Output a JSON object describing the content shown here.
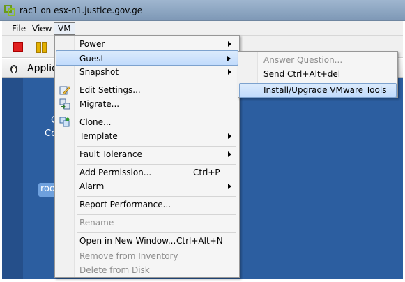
{
  "window": {
    "title": "rac1 on esx-n1.justice.gov.ge"
  },
  "menubar": {
    "items": [
      "File",
      "View",
      "VM"
    ],
    "active": "VM"
  },
  "toolbar": {
    "buttons": [
      "stop-icon",
      "pause-icon"
    ]
  },
  "appbar": {
    "label": "Applic"
  },
  "desktop": {
    "partial_text_1": "C",
    "partial_text_2": "Co",
    "user_badge": "roo"
  },
  "vm_menu": {
    "items": [
      {
        "label": "Power",
        "submenu": true
      },
      {
        "label": "Guest",
        "submenu": true,
        "highlighted": true
      },
      {
        "label": "Snapshot",
        "submenu": true
      },
      {
        "label": "Edit Settings...",
        "icon": "edit-settings-icon"
      },
      {
        "label": "Migrate...",
        "icon": "migrate-icon"
      },
      {
        "label": "Clone...",
        "icon": "clone-icon"
      },
      {
        "label": "Template",
        "submenu": true
      },
      {
        "label": "Fault Tolerance",
        "submenu": true
      },
      {
        "label": "Add Permission...",
        "shortcut": "Ctrl+P"
      },
      {
        "label": "Alarm",
        "submenu": true
      },
      {
        "label": "Report Performance..."
      },
      {
        "label": "Rename",
        "disabled": true
      },
      {
        "label": "Open in New Window...",
        "shortcut": "Ctrl+Alt+N"
      },
      {
        "label": "Remove from Inventory",
        "disabled": true
      },
      {
        "label": "Delete from Disk",
        "disabled": true
      }
    ]
  },
  "guest_submenu": {
    "items": [
      {
        "label": "Answer Question...",
        "disabled": true
      },
      {
        "label": "Send Ctrl+Alt+del"
      },
      {
        "label": "Install/Upgrade VMware Tools",
        "highlighted": true
      }
    ]
  },
  "colors": {
    "highlight": "#c1dbfc",
    "desktop": "#2c5ea0",
    "disabled_text": "#8d8d8d"
  }
}
